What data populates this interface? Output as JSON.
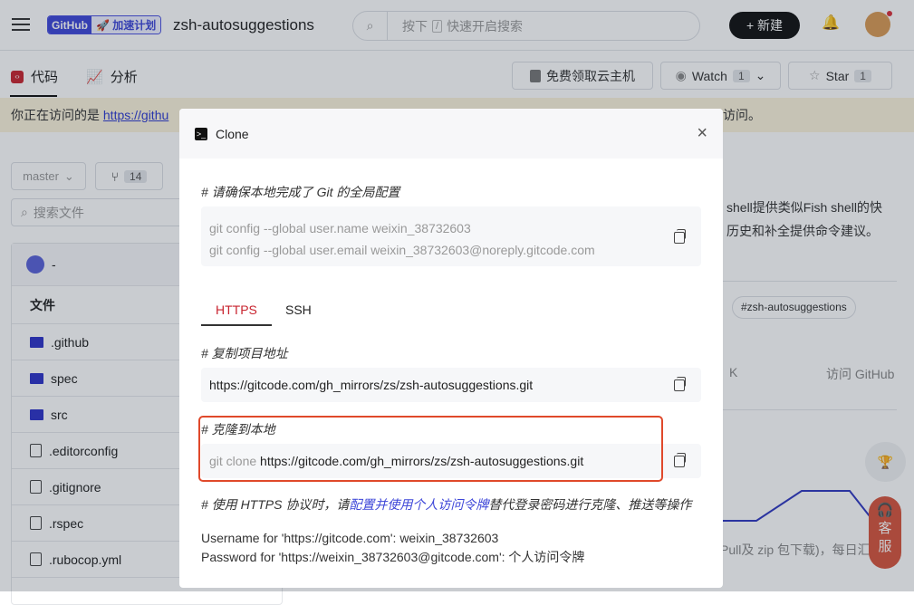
{
  "header": {
    "badge_left": "GitHub",
    "badge_right": "加速计划",
    "repo_title": "zsh-autosuggestions",
    "search_pre": "按下",
    "search_key": "/",
    "search_post": "快速开启搜索",
    "new_button": "+ 新建"
  },
  "tabs": [
    {
      "label": "代码",
      "active": true
    },
    {
      "label": "分析"
    }
  ],
  "actions": {
    "cloud": "免费领取云主机",
    "watch": "Watch",
    "watch_count": "1",
    "star": "Star",
    "star_count": "1"
  },
  "banner": {
    "prefix": "你正在访问的是",
    "link": "https://githu",
    "suffix": "访问。"
  },
  "left": {
    "branch": "master",
    "branch_count": "14",
    "search_placeholder": "搜索文件",
    "commit_author": "-",
    "files_header": "文件",
    "files": [
      {
        "name": ".github",
        "type": "folder"
      },
      {
        "name": "spec",
        "type": "folder"
      },
      {
        "name": "src",
        "type": "folder"
      },
      {
        "name": ".editorconfig",
        "type": "file"
      },
      {
        "name": ".gitignore",
        "type": "code"
      },
      {
        "name": ".rspec",
        "type": "file"
      },
      {
        "name": ".rubocop.yml",
        "type": "code"
      }
    ]
  },
  "right": {
    "desc_line1": "shell提供类似Fish shell的快",
    "desc_line2": "历史和补全提供命令建议。",
    "tag": "#zsh-autosuggestions",
    "stat_k": "K",
    "visit_github": "访问 GitHub",
    "bottom_text": "Pull及 zip 包下载)，每日汇",
    "service": "客服"
  },
  "modal": {
    "title": "Clone",
    "config_comment": "# 请确保本地完成了 Git 的全局配置",
    "config_line1": "git config --global user.name weixin_38732603",
    "config_line2": "git config --global user.email weixin_38732603@noreply.gitcode.com",
    "tabs": [
      {
        "label": "HTTPS",
        "active": true
      },
      {
        "label": "SSH"
      }
    ],
    "copy_comment": "# 复制项目地址",
    "repo_url": "https://gitcode.com/gh_mirrors/zs/zsh-autosuggestions.git",
    "clone_comment": "# 克隆到本地",
    "clone_prefix": "git clone",
    "clone_url": "https://gitcode.com/gh_mirrors/zs/zsh-autosuggestions.git",
    "https_note_pre": "# 使用 HTTPS 协议时，请",
    "https_note_link": "配置并使用个人访问令牌",
    "https_note_post": "替代登录密码进行克隆、推送等操作",
    "username_line": "Username for 'https://gitcode.com': weixin_38732603",
    "password_line": "Password for 'https://weixin_38732603@gitcode.com': 个人访问令牌"
  },
  "colors": {
    "accent_red": "#c8242f",
    "highlight_box": "#e0492b",
    "link_blue": "#3d46d8",
    "folder": "#2d32c8"
  }
}
